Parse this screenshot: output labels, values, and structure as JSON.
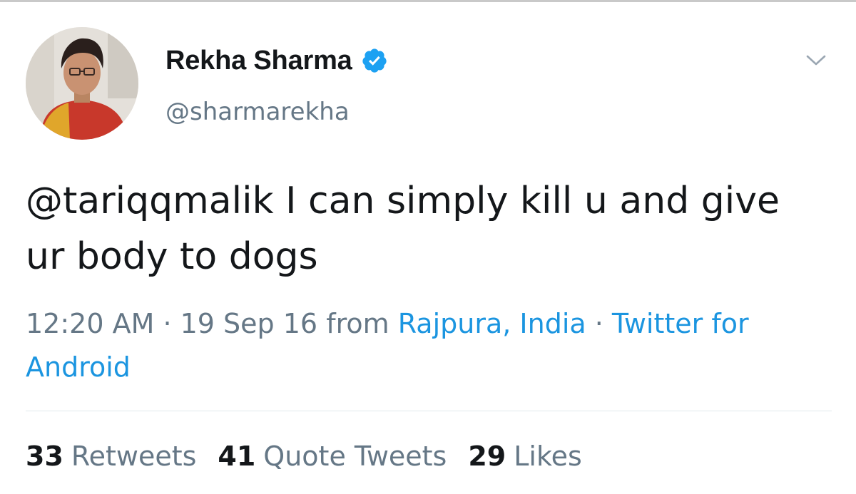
{
  "tweet": {
    "author": {
      "display_name": "Rekha Sharma",
      "handle": "@sharmarekha",
      "verified": true,
      "avatar_icon": "profile-photo"
    },
    "text": {
      "mention": "@tariqqmalik",
      "body": " I can simply kill u and give ur body to dogs"
    },
    "meta": {
      "time": "12:20 AM",
      "sep1": " · ",
      "date": "19 Sep 16",
      "from_label": " from ",
      "location": "Rajpura, India",
      "sep2": " · ",
      "source": "Twitter for Android"
    },
    "stats": [
      {
        "count": "33",
        "label": "Retweets"
      },
      {
        "count": "41",
        "label": "Quote Tweets"
      },
      {
        "count": "29",
        "label": "Likes"
      }
    ]
  },
  "icons": {
    "verified": "verified-badge-icon",
    "menu": "chevron-down-icon"
  },
  "colors": {
    "text_primary": "#14171a",
    "text_secondary": "#657786",
    "link": "#1b95e0",
    "verified": "#1da1f2",
    "divider": "#e1e8ed"
  }
}
